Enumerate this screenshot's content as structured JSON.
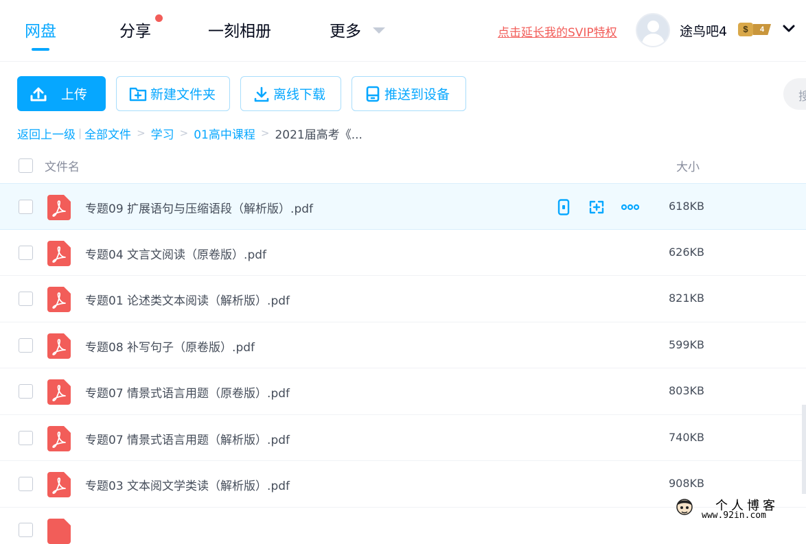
{
  "nav": {
    "tabs": [
      {
        "label": "网盘",
        "active": true
      },
      {
        "label": "分享",
        "has_dot": true
      },
      {
        "label": "一刻相册"
      },
      {
        "label": "更多"
      }
    ],
    "svip_link": "点击延长我的SVIP特权",
    "username": "途鸟吧4",
    "badge_symbol": "$",
    "badge_level": "4"
  },
  "toolbar": {
    "upload": "上传",
    "new_folder": "新建文件夹",
    "offline_download": "离线下载",
    "push_device": "推送到设备",
    "search_placeholder": "搜"
  },
  "breadcrumb": {
    "back": "返回上一级",
    "divider": "|",
    "items": [
      "全部文件",
      "学习",
      "01高中课程"
    ],
    "separator": ">",
    "current": "2021届高考《..."
  },
  "table": {
    "col_name": "文件名",
    "col_size": "大小",
    "rows": [
      {
        "name": "专题09 扩展语句与压缩语段（解析版）.pdf",
        "size": "618KB",
        "hover": true
      },
      {
        "name": "专题04 文言文阅读（原卷版）.pdf",
        "size": "626KB"
      },
      {
        "name": "专题01 论述类文本阅读（解析版）.pdf",
        "size": "821KB"
      },
      {
        "name": "专题08 补写句子（原卷版）.pdf",
        "size": "599KB"
      },
      {
        "name": "专题07 情景式语言用题（原卷版）.pdf",
        "size": "803KB"
      },
      {
        "name": "专题07 情景式语言用题（解析版）.pdf",
        "size": "740KB"
      },
      {
        "name": "专题03 文本阅文学类读（解析版）.pdf",
        "size": "908KB"
      }
    ]
  },
  "watermark": {
    "title": "个人博客",
    "url": "www.92in.com"
  },
  "colors": {
    "accent": "#06a7ff",
    "pdf_red": "#f25d59",
    "svip_red": "#f25d59"
  }
}
